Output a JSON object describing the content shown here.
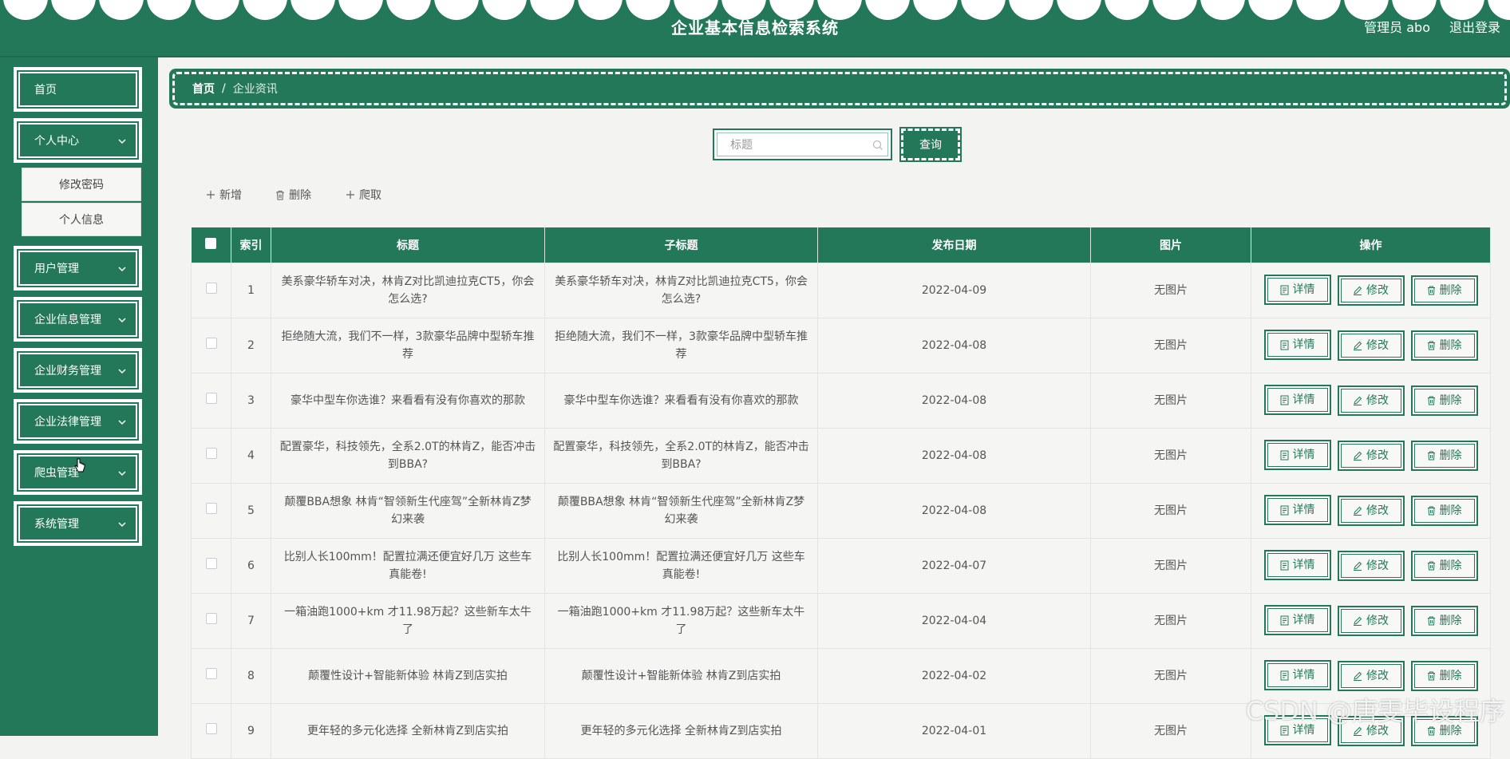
{
  "header": {
    "title": "企业基本信息检索系统",
    "admin": "管理员 abo",
    "logout": "退出登录"
  },
  "sidebar": {
    "items": [
      {
        "label": "首页",
        "expandable": false
      },
      {
        "label": "个人中心",
        "expandable": true
      },
      {
        "label": "用户管理",
        "expandable": true
      },
      {
        "label": "企业信息管理",
        "expandable": true
      },
      {
        "label": "企业财务管理",
        "expandable": true
      },
      {
        "label": "企业法律管理",
        "expandable": true
      },
      {
        "label": "爬虫管理",
        "expandable": true
      },
      {
        "label": "系统管理",
        "expandable": true
      }
    ],
    "submenu": [
      "修改密码",
      "个人信息"
    ]
  },
  "breadcrumb": {
    "home": "首页",
    "separator": "/",
    "current": "企业资讯"
  },
  "search": {
    "placeholder": "标题",
    "button": "查询"
  },
  "toolbar": {
    "add": "新增",
    "delete": "删除",
    "crawl": "爬取"
  },
  "table": {
    "columns": [
      "索引",
      "标题",
      "子标题",
      "发布日期",
      "图片",
      "操作"
    ],
    "actions": {
      "detail": "详情",
      "edit": "修改",
      "delete": "删除"
    },
    "rows": [
      {
        "index": "1",
        "title": "美系豪华轿车对决，林肯Z对比凯迪拉克CT5，你会怎么选?",
        "subtitle": "美系豪华轿车对决，林肯Z对比凯迪拉克CT5，你会怎么选?",
        "date": "2022-04-09",
        "image": "无图片"
      },
      {
        "index": "2",
        "title": "拒绝随大流，我们不一样，3款豪华品牌中型轿车推荐",
        "subtitle": "拒绝随大流，我们不一样，3款豪华品牌中型轿车推荐",
        "date": "2022-04-08",
        "image": "无图片"
      },
      {
        "index": "3",
        "title": "豪华中型车你选谁？来看看有没有你喜欢的那款",
        "subtitle": "豪华中型车你选谁？来看看有没有你喜欢的那款",
        "date": "2022-04-08",
        "image": "无图片"
      },
      {
        "index": "4",
        "title": "配置豪华，科技领先，全系2.0T的林肯Z，能否冲击到BBA?",
        "subtitle": "配置豪华，科技领先，全系2.0T的林肯Z，能否冲击到BBA?",
        "date": "2022-04-08",
        "image": "无图片"
      },
      {
        "index": "5",
        "title": "颠覆BBA想象 林肯“智领新生代座驾”全新林肯Z梦幻来袭",
        "subtitle": "颠覆BBA想象 林肯“智领新生代座驾”全新林肯Z梦幻来袭",
        "date": "2022-04-08",
        "image": "无图片"
      },
      {
        "index": "6",
        "title": "比别人长100mm！配置拉满还便宜好几万 这些车真能卷!",
        "subtitle": "比别人长100mm！配置拉满还便宜好几万 这些车真能卷!",
        "date": "2022-04-07",
        "image": "无图片"
      },
      {
        "index": "7",
        "title": "一箱油跑1000+km 才11.98万起？这些新车太牛了",
        "subtitle": "一箱油跑1000+km 才11.98万起？这些新车太牛了",
        "date": "2022-04-04",
        "image": "无图片"
      },
      {
        "index": "8",
        "title": "颠覆性设计+智能新体验 林肯Z到店实拍",
        "subtitle": "颠覆性设计+智能新体验 林肯Z到店实拍",
        "date": "2022-04-02",
        "image": "无图片"
      },
      {
        "index": "9",
        "title": "更年轻的多元化选择 全新林肯Z到店实拍",
        "subtitle": "更年轻的多元化选择 全新林肯Z到店实拍",
        "date": "2022-04-01",
        "image": "无图片"
      }
    ]
  },
  "watermark": "CSDN @唐雯毕设程序",
  "colors": {
    "primary": "#24785a",
    "background": "#f3f3f1"
  }
}
